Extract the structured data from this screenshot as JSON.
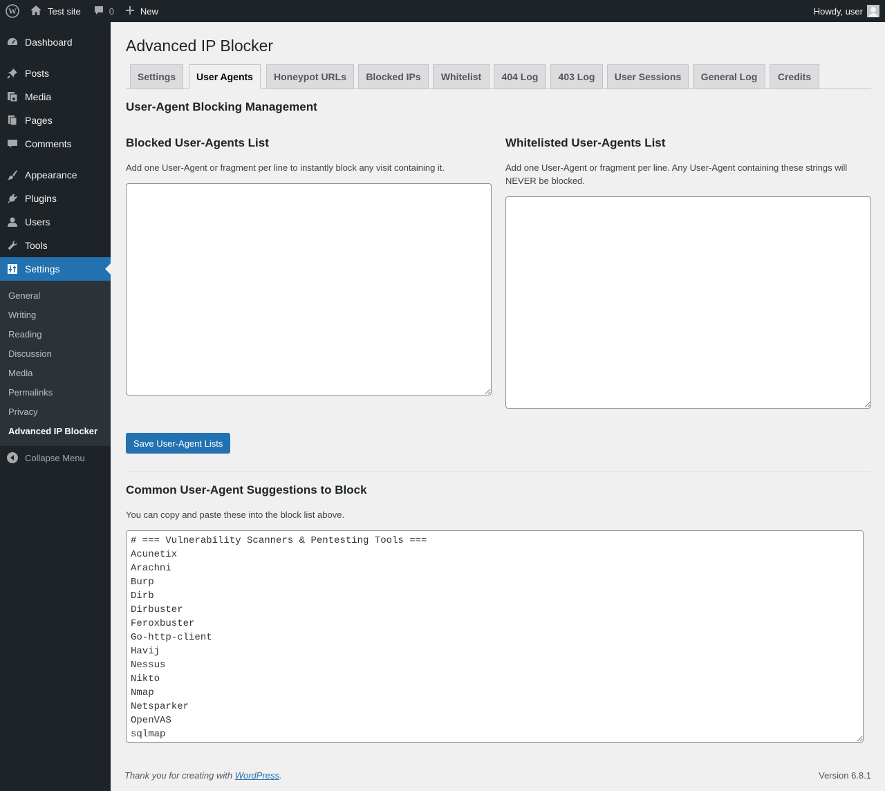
{
  "adminbar": {
    "site_name": "Test site",
    "comments_count": "0",
    "new_label": "New",
    "greeting": "Howdy, user"
  },
  "sidebar": {
    "items": [
      {
        "label": "Dashboard",
        "icon": "dashboard-icon"
      },
      {
        "label": "Posts",
        "icon": "pushpin-icon"
      },
      {
        "label": "Media",
        "icon": "media-icon"
      },
      {
        "label": "Pages",
        "icon": "pages-icon"
      },
      {
        "label": "Comments",
        "icon": "comment-icon"
      },
      {
        "label": "Appearance",
        "icon": "brush-icon"
      },
      {
        "label": "Plugins",
        "icon": "plug-icon"
      },
      {
        "label": "Users",
        "icon": "user-icon"
      },
      {
        "label": "Tools",
        "icon": "wrench-icon"
      },
      {
        "label": "Settings",
        "icon": "sliders-icon"
      }
    ],
    "submenu": [
      "General",
      "Writing",
      "Reading",
      "Discussion",
      "Media",
      "Permalinks",
      "Privacy",
      "Advanced IP Blocker"
    ],
    "collapse_label": "Collapse Menu"
  },
  "page": {
    "title": "Advanced IP Blocker",
    "tabs": [
      "Settings",
      "User Agents",
      "Honeypot URLs",
      "Blocked IPs",
      "Whitelist",
      "404 Log",
      "403 Log",
      "User Sessions",
      "General Log",
      "Credits"
    ],
    "active_tab": "User Agents",
    "heading": "User-Agent Blocking Management",
    "blocked": {
      "title": "Blocked User-Agents List",
      "description": "Add one User-Agent or fragment per line to instantly block any visit containing it.",
      "value": ""
    },
    "whitelisted": {
      "title": "Whitelisted User-Agents List",
      "description": "Add one User-Agent or fragment per line. Any User-Agent containing these strings will NEVER be blocked.",
      "value": ""
    },
    "save_button": "Save User-Agent Lists",
    "suggestions": {
      "title": "Common User-Agent Suggestions to Block",
      "description": "You can copy and paste these into the block list above.",
      "value": "# === Vulnerability Scanners & Pentesting Tools ===\nAcunetix\nArachni\nBurp\nDirb\nDirbuster\nFeroxbuster\nGo-http-client\nHavij\nNessus\nNikto\nNmap\nNetsparker\nOpenVAS\nsqlmap"
    }
  },
  "footer": {
    "thanks_prefix": "Thank you for creating with ",
    "thanks_link": "WordPress",
    "thanks_suffix": ".",
    "version": "Version 6.8.1"
  }
}
